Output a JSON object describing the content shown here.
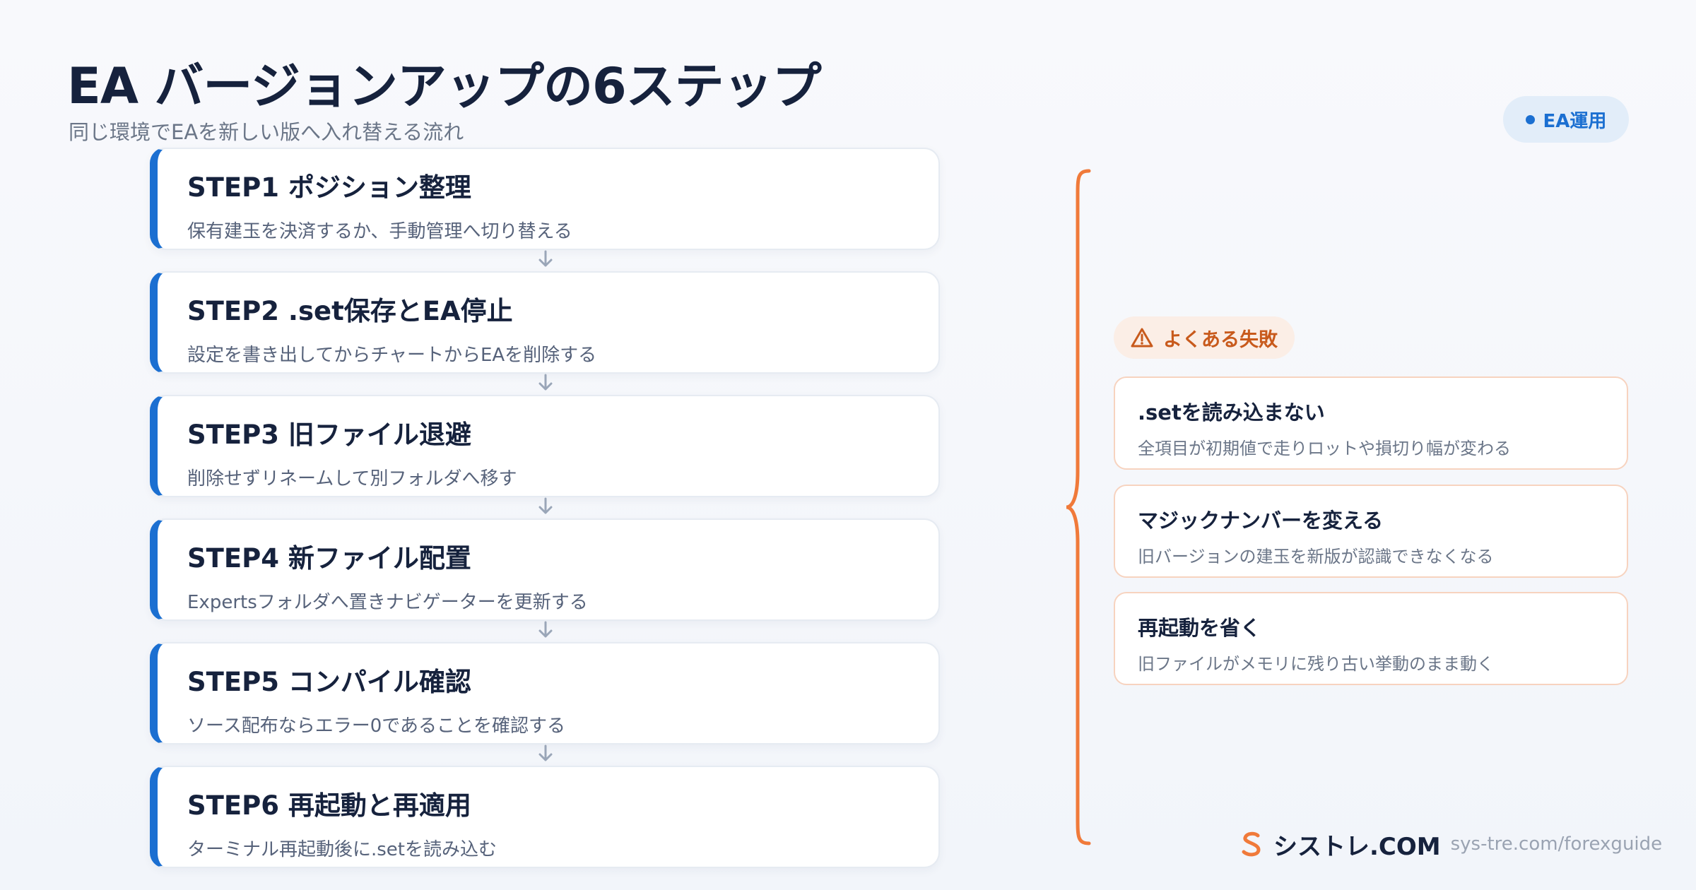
{
  "header": {
    "title": "EA バージョンアップの6ステップ",
    "subtitle": "同じ環境でEAを新しい版へ入れ替える流れ",
    "tag": "EA運用"
  },
  "steps": [
    {
      "title": "STEP1 ポジション整理",
      "desc": "保有建玉を決済するか、手動管理へ切り替える"
    },
    {
      "title": "STEP2 .set保存とEA停止",
      "desc": "設定を書き出してからチャートからEAを削除する"
    },
    {
      "title": "STEP3 旧ファイル退避",
      "desc": "削除せずリネームして別フォルダへ移す"
    },
    {
      "title": "STEP4 新ファイル配置",
      "desc": "Expertsフォルダへ置きナビゲーターを更新する"
    },
    {
      "title": "STEP5 コンパイル確認",
      "desc": "ソース配布ならエラー0であることを確認する"
    },
    {
      "title": "STEP6 再起動と再適用",
      "desc": "ターミナル再起動後に.setを読み込む"
    }
  ],
  "failures": {
    "label": "よくある失敗",
    "items": [
      {
        "title": ".setを読み込まない",
        "desc": "全項目が初期値で走りロットや損切り幅が変わる"
      },
      {
        "title": "マジックナンバーを変える",
        "desc": "旧バージョンの建玉を新版が認識できなくなる"
      },
      {
        "title": "再起動を省く",
        "desc": "旧ファイルがメモリに残り古い挙動のまま動く"
      }
    ]
  },
  "footer": {
    "brand": "シストレ.COM",
    "url": "sys-tre.com/forexguide"
  },
  "colors": {
    "accent": "#1b6fd1",
    "warning": "#c85a1c",
    "brace": "#f07a3a"
  }
}
